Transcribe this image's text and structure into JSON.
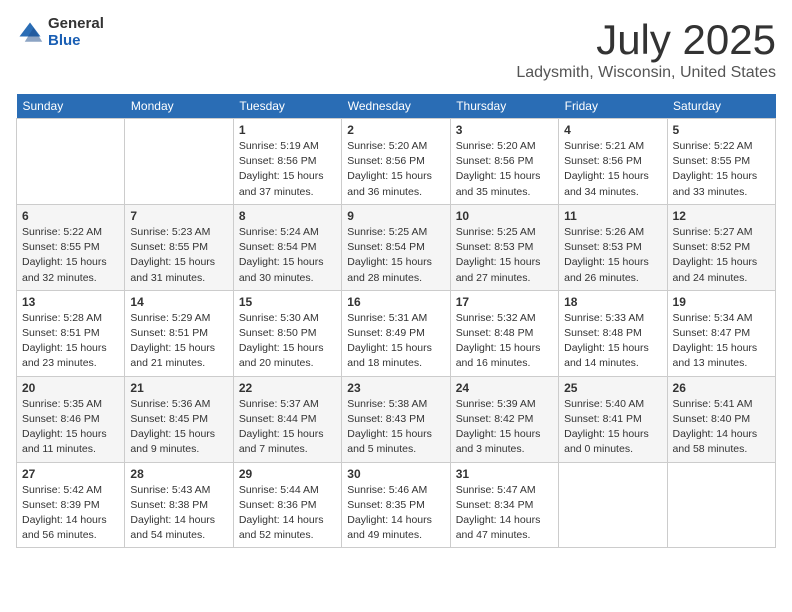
{
  "header": {
    "logo_general": "General",
    "logo_blue": "Blue",
    "month_title": "July 2025",
    "location": "Ladysmith, Wisconsin, United States"
  },
  "weekdays": [
    "Sunday",
    "Monday",
    "Tuesday",
    "Wednesday",
    "Thursday",
    "Friday",
    "Saturday"
  ],
  "weeks": [
    [
      {
        "day": "",
        "info": ""
      },
      {
        "day": "",
        "info": ""
      },
      {
        "day": "1",
        "sunrise": "Sunrise: 5:19 AM",
        "sunset": "Sunset: 8:56 PM",
        "daylight": "Daylight: 15 hours and 37 minutes."
      },
      {
        "day": "2",
        "sunrise": "Sunrise: 5:20 AM",
        "sunset": "Sunset: 8:56 PM",
        "daylight": "Daylight: 15 hours and 36 minutes."
      },
      {
        "day": "3",
        "sunrise": "Sunrise: 5:20 AM",
        "sunset": "Sunset: 8:56 PM",
        "daylight": "Daylight: 15 hours and 35 minutes."
      },
      {
        "day": "4",
        "sunrise": "Sunrise: 5:21 AM",
        "sunset": "Sunset: 8:56 PM",
        "daylight": "Daylight: 15 hours and 34 minutes."
      },
      {
        "day": "5",
        "sunrise": "Sunrise: 5:22 AM",
        "sunset": "Sunset: 8:55 PM",
        "daylight": "Daylight: 15 hours and 33 minutes."
      }
    ],
    [
      {
        "day": "6",
        "sunrise": "Sunrise: 5:22 AM",
        "sunset": "Sunset: 8:55 PM",
        "daylight": "Daylight: 15 hours and 32 minutes."
      },
      {
        "day": "7",
        "sunrise": "Sunrise: 5:23 AM",
        "sunset": "Sunset: 8:55 PM",
        "daylight": "Daylight: 15 hours and 31 minutes."
      },
      {
        "day": "8",
        "sunrise": "Sunrise: 5:24 AM",
        "sunset": "Sunset: 8:54 PM",
        "daylight": "Daylight: 15 hours and 30 minutes."
      },
      {
        "day": "9",
        "sunrise": "Sunrise: 5:25 AM",
        "sunset": "Sunset: 8:54 PM",
        "daylight": "Daylight: 15 hours and 28 minutes."
      },
      {
        "day": "10",
        "sunrise": "Sunrise: 5:25 AM",
        "sunset": "Sunset: 8:53 PM",
        "daylight": "Daylight: 15 hours and 27 minutes."
      },
      {
        "day": "11",
        "sunrise": "Sunrise: 5:26 AM",
        "sunset": "Sunset: 8:53 PM",
        "daylight": "Daylight: 15 hours and 26 minutes."
      },
      {
        "day": "12",
        "sunrise": "Sunrise: 5:27 AM",
        "sunset": "Sunset: 8:52 PM",
        "daylight": "Daylight: 15 hours and 24 minutes."
      }
    ],
    [
      {
        "day": "13",
        "sunrise": "Sunrise: 5:28 AM",
        "sunset": "Sunset: 8:51 PM",
        "daylight": "Daylight: 15 hours and 23 minutes."
      },
      {
        "day": "14",
        "sunrise": "Sunrise: 5:29 AM",
        "sunset": "Sunset: 8:51 PM",
        "daylight": "Daylight: 15 hours and 21 minutes."
      },
      {
        "day": "15",
        "sunrise": "Sunrise: 5:30 AM",
        "sunset": "Sunset: 8:50 PM",
        "daylight": "Daylight: 15 hours and 20 minutes."
      },
      {
        "day": "16",
        "sunrise": "Sunrise: 5:31 AM",
        "sunset": "Sunset: 8:49 PM",
        "daylight": "Daylight: 15 hours and 18 minutes."
      },
      {
        "day": "17",
        "sunrise": "Sunrise: 5:32 AM",
        "sunset": "Sunset: 8:48 PM",
        "daylight": "Daylight: 15 hours and 16 minutes."
      },
      {
        "day": "18",
        "sunrise": "Sunrise: 5:33 AM",
        "sunset": "Sunset: 8:48 PM",
        "daylight": "Daylight: 15 hours and 14 minutes."
      },
      {
        "day": "19",
        "sunrise": "Sunrise: 5:34 AM",
        "sunset": "Sunset: 8:47 PM",
        "daylight": "Daylight: 15 hours and 13 minutes."
      }
    ],
    [
      {
        "day": "20",
        "sunrise": "Sunrise: 5:35 AM",
        "sunset": "Sunset: 8:46 PM",
        "daylight": "Daylight: 15 hours and 11 minutes."
      },
      {
        "day": "21",
        "sunrise": "Sunrise: 5:36 AM",
        "sunset": "Sunset: 8:45 PM",
        "daylight": "Daylight: 15 hours and 9 minutes."
      },
      {
        "day": "22",
        "sunrise": "Sunrise: 5:37 AM",
        "sunset": "Sunset: 8:44 PM",
        "daylight": "Daylight: 15 hours and 7 minutes."
      },
      {
        "day": "23",
        "sunrise": "Sunrise: 5:38 AM",
        "sunset": "Sunset: 8:43 PM",
        "daylight": "Daylight: 15 hours and 5 minutes."
      },
      {
        "day": "24",
        "sunrise": "Sunrise: 5:39 AM",
        "sunset": "Sunset: 8:42 PM",
        "daylight": "Daylight: 15 hours and 3 minutes."
      },
      {
        "day": "25",
        "sunrise": "Sunrise: 5:40 AM",
        "sunset": "Sunset: 8:41 PM",
        "daylight": "Daylight: 15 hours and 0 minutes."
      },
      {
        "day": "26",
        "sunrise": "Sunrise: 5:41 AM",
        "sunset": "Sunset: 8:40 PM",
        "daylight": "Daylight: 14 hours and 58 minutes."
      }
    ],
    [
      {
        "day": "27",
        "sunrise": "Sunrise: 5:42 AM",
        "sunset": "Sunset: 8:39 PM",
        "daylight": "Daylight: 14 hours and 56 minutes."
      },
      {
        "day": "28",
        "sunrise": "Sunrise: 5:43 AM",
        "sunset": "Sunset: 8:38 PM",
        "daylight": "Daylight: 14 hours and 54 minutes."
      },
      {
        "day": "29",
        "sunrise": "Sunrise: 5:44 AM",
        "sunset": "Sunset: 8:36 PM",
        "daylight": "Daylight: 14 hours and 52 minutes."
      },
      {
        "day": "30",
        "sunrise": "Sunrise: 5:46 AM",
        "sunset": "Sunset: 8:35 PM",
        "daylight": "Daylight: 14 hours and 49 minutes."
      },
      {
        "day": "31",
        "sunrise": "Sunrise: 5:47 AM",
        "sunset": "Sunset: 8:34 PM",
        "daylight": "Daylight: 14 hours and 47 minutes."
      },
      {
        "day": "",
        "info": ""
      },
      {
        "day": "",
        "info": ""
      }
    ]
  ]
}
